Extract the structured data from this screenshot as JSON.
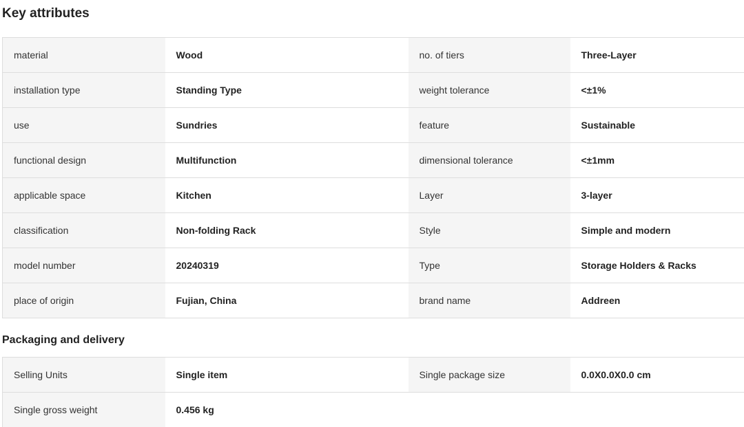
{
  "key_attributes": {
    "title": "Key attributes",
    "rows": [
      [
        {
          "label": "material",
          "value": "Wood"
        },
        {
          "label": "no. of tiers",
          "value": "Three-Layer"
        }
      ],
      [
        {
          "label": "installation type",
          "value": "Standing Type"
        },
        {
          "label": "weight tolerance",
          "value": "<±1%"
        }
      ],
      [
        {
          "label": "use",
          "value": "Sundries"
        },
        {
          "label": "feature",
          "value": "Sustainable"
        }
      ],
      [
        {
          "label": "functional design",
          "value": "Multifunction"
        },
        {
          "label": "dimensional tolerance",
          "value": "<±1mm"
        }
      ],
      [
        {
          "label": "applicable space",
          "value": "Kitchen"
        },
        {
          "label": "Layer",
          "value": "3-layer"
        }
      ],
      [
        {
          "label": "classification",
          "value": "Non-folding Rack"
        },
        {
          "label": "Style",
          "value": "Simple and modern"
        }
      ],
      [
        {
          "label": "model number",
          "value": "20240319"
        },
        {
          "label": "Type",
          "value": "Storage Holders & Racks"
        }
      ],
      [
        {
          "label": "place of origin",
          "value": "Fujian, China"
        },
        {
          "label": "brand name",
          "value": "Addreen"
        }
      ]
    ]
  },
  "packaging": {
    "title": "Packaging and delivery",
    "rows": [
      [
        {
          "label": "Selling Units",
          "value": "Single item"
        },
        {
          "label": "Single package size",
          "value": "0.0X0.0X0.0 cm"
        }
      ],
      [
        {
          "label": "Single gross weight",
          "value": "0.456 kg"
        }
      ]
    ]
  }
}
